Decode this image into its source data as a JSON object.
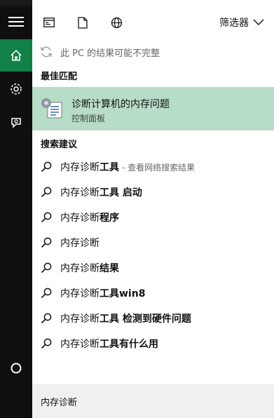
{
  "sidebar": {
    "items": [
      {
        "name": "hamburger-menu"
      },
      {
        "name": "home",
        "active": true
      },
      {
        "name": "settings"
      },
      {
        "name": "feedback"
      }
    ]
  },
  "topbar": {
    "filter_label": "筛选器"
  },
  "notice": {
    "text": "此 PC 的结果可能不完整"
  },
  "sections": {
    "best_match": "最佳匹配",
    "suggestions": "搜索建议"
  },
  "best_match": {
    "title": "诊断计算机的内存问题",
    "subtitle": "控制面板"
  },
  "suggestions": [
    {
      "prefix": "内存诊断",
      "bold": "工具",
      "hint": "- 查看网络搜索结果"
    },
    {
      "prefix": "内存诊断",
      "bold": "工具 启动",
      "hint": ""
    },
    {
      "prefix": "内存诊断",
      "bold": "程序",
      "hint": ""
    },
    {
      "prefix": "内存诊断",
      "bold": "",
      "hint": ""
    },
    {
      "prefix": "内存诊断",
      "bold": "结果",
      "hint": ""
    },
    {
      "prefix": "内存诊断",
      "bold": "工具win8",
      "hint": ""
    },
    {
      "prefix": "内存诊断",
      "bold": "工具 检测到硬件问题",
      "hint": ""
    },
    {
      "prefix": "内存诊断",
      "bold": "工具有什么用",
      "hint": ""
    }
  ],
  "search_box": {
    "value": "内存诊断"
  }
}
